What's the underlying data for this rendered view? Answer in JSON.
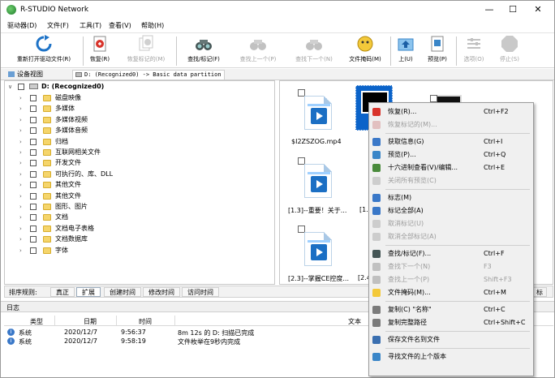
{
  "window": {
    "title": "R-STUDIO Network",
    "minimize": "—",
    "maximize": "☐",
    "close": "✕"
  },
  "menubar": [
    "驱动器(D)",
    "文件(F)",
    "工具(T)",
    "查看(V)",
    "帮助(H)"
  ],
  "toolbar": [
    {
      "label": "重新打开驱动文件(R)",
      "icon": "refresh-icon",
      "enabled": true
    },
    {
      "label": "恢复(R)",
      "icon": "recover-icon",
      "enabled": true
    },
    {
      "label": "恢复标记的(M)",
      "icon": "recover-marked-icon",
      "enabled": false
    },
    {
      "label": "查找/标记(F)",
      "icon": "binoculars-icon",
      "enabled": true
    },
    {
      "label": "查找上一个(P)",
      "icon": "find-previous-icon",
      "enabled": false
    },
    {
      "label": "查找下一个(N)",
      "icon": "find-next-icon",
      "enabled": false
    },
    {
      "label": "文件掩码(M)",
      "icon": "file-mask-icon",
      "enabled": true
    },
    {
      "label": "上(U)",
      "icon": "folder-up-icon",
      "enabled": true
    },
    {
      "label": "预览(P)",
      "icon": "preview-icon",
      "enabled": true
    },
    {
      "label": "选项(O)",
      "icon": "options-icon",
      "enabled": false
    },
    {
      "label": "停止(S)",
      "icon": "stop-icon",
      "enabled": false
    }
  ],
  "nav": {
    "device_tab": "设备视图",
    "path": "D: (Recognized0) -> Basic data partition"
  },
  "tree": {
    "root": "D: (Recognized0)",
    "folders": [
      "磁盘映像",
      "多媒体",
      "多媒体视频",
      "多媒体音频",
      "归档",
      "互联网相关文件",
      "开发文件",
      "可执行的、库、DLL",
      "其他文件",
      "其他文件",
      "图形、图片",
      "文档",
      "文档电子表格",
      "文档数据库",
      "字体"
    ]
  },
  "files": [
    {
      "name": "$I2ZSZOG.mp4"
    },
    {
      "name": "[1.3]--重要！关于..."
    },
    {
      "name": "[2.3]--掌握CE控度..."
    }
  ],
  "files_partial": [
    "[1.",
    "[2.4"
  ],
  "sortbar": {
    "label": "排序规则:",
    "options": [
      "真正",
      "扩展",
      "创建时间",
      "修改时间",
      "访问时间"
    ],
    "active": "扩展",
    "right_fragment": "标"
  },
  "log": {
    "title": "日志",
    "columns": [
      "类型",
      "日期",
      "时间",
      "文本"
    ],
    "rows": [
      {
        "type": "系统",
        "date": "2020/12/7",
        "time": "9:56:37",
        "text": "8m 12s 的 D: 扫描已完成"
      },
      {
        "type": "系统",
        "date": "2020/12/7",
        "time": "9:58:19",
        "text": "文件枚举在9秒内完成"
      }
    ]
  },
  "context_menu": [
    {
      "label": "恢复(R)...",
      "shortcut": "Ctrl+F2",
      "icon": "recover-icon",
      "enabled": true
    },
    {
      "label": "恢复标记的(M)...",
      "shortcut": "",
      "icon": "recover-marked-icon",
      "enabled": false
    },
    {
      "sep": true
    },
    {
      "label": "获取信息(G)",
      "shortcut": "Ctrl+I",
      "icon": "info-icon",
      "enabled": true
    },
    {
      "label": "预览(P)...",
      "shortcut": "Ctrl+Q",
      "icon": "preview-icon",
      "enabled": true
    },
    {
      "label": "十六进制查看(V)/编辑...",
      "shortcut": "Ctrl+E",
      "icon": "hex-icon",
      "enabled": true
    },
    {
      "label": "关闭所有预览(C)",
      "shortcut": "",
      "icon": "close-previews-icon",
      "enabled": false
    },
    {
      "sep": true
    },
    {
      "label": "标志(M)",
      "shortcut": "",
      "icon": "check-icon",
      "enabled": true
    },
    {
      "label": "标记全部(A)",
      "shortcut": "",
      "icon": "mark-all-icon",
      "enabled": true
    },
    {
      "label": "取消标记(U)",
      "shortcut": "",
      "icon": "unmark-icon",
      "enabled": false
    },
    {
      "label": "取消全部标记(A)",
      "shortcut": "",
      "icon": "unmark-all-icon",
      "enabled": false
    },
    {
      "sep": true
    },
    {
      "label": "查找/标记(F)...",
      "shortcut": "Ctrl+F",
      "icon": "binoculars-icon",
      "enabled": true
    },
    {
      "label": "查找下一个(N)",
      "shortcut": "F3",
      "icon": "find-next-icon",
      "enabled": false
    },
    {
      "label": "查找上一个(P)",
      "shortcut": "Shift+F3",
      "icon": "find-previous-icon",
      "enabled": false
    },
    {
      "label": "文件掩码(M)...",
      "shortcut": "Ctrl+M",
      "icon": "file-mask-icon",
      "enabled": true
    },
    {
      "sep": true
    },
    {
      "label": "复制(C) \"名称\"",
      "shortcut": "Ctrl+C",
      "icon": "copy-icon",
      "enabled": true
    },
    {
      "label": "复制完整路径",
      "shortcut": "Ctrl+Shift+C",
      "icon": "copy-path-icon",
      "enabled": true
    },
    {
      "sep": true
    },
    {
      "label": "保存文件名到文件",
      "shortcut": "",
      "icon": "save-icon",
      "enabled": true
    },
    {
      "sep": true
    },
    {
      "label": "寻找文件的上个版本",
      "shortcut": "",
      "icon": "versions-icon",
      "enabled": true
    }
  ],
  "colors": {
    "selection": "#0b63c9",
    "folder": "#f5d56b",
    "play": "#1b6fc4"
  }
}
